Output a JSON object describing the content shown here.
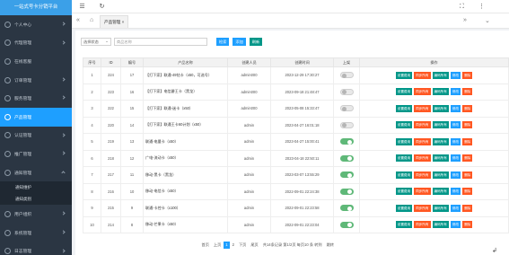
{
  "brand": "一站式号卡分销平台",
  "nav": [
    {
      "label": "个人中心",
      "chev": true
    },
    {
      "label": "代理管理",
      "chev": true
    },
    {
      "label": "在线客服",
      "chev": false
    },
    {
      "label": "订单管理",
      "chev": true
    },
    {
      "label": "服务管理",
      "chev": true
    },
    {
      "label": "产品管理",
      "active": true
    },
    {
      "label": "认证管理",
      "chev": true
    },
    {
      "label": "推广管理",
      "chev": true
    },
    {
      "label": "通知管理",
      "chev": true,
      "open": true,
      "subs": [
        "通知维护",
        "通知类别"
      ]
    },
    {
      "label": "用户组织",
      "chev": true
    },
    {
      "label": "系统管理",
      "chev": true
    },
    {
      "label": "日志管理",
      "chev": true
    }
  ],
  "topbar": {
    "menu_icon": "menu-icon",
    "refresh_icon": "refresh-icon"
  },
  "tabs": {
    "current": "产品管理"
  },
  "toolbar": {
    "select_value": "选择状态",
    "search_placeholder": "商品名称",
    "search_label": "检索",
    "add_label": "添加",
    "refresh_label": "刷新"
  },
  "table": {
    "headers": [
      "序号",
      "ID",
      "编号",
      "产品名称",
      "创建人员",
      "创建时间",
      "上架",
      "操作"
    ],
    "actions": [
      "设置费用",
      "同步所有",
      "编码所有",
      "修改",
      "删除"
    ],
    "rows": [
      {
        "seq": "1",
        "id": "224",
        "no": "17",
        "name": "【打下家】联通-49钻卡（x50，可选号）",
        "creator": "admin000",
        "time": "2023-12-29 17:30:27",
        "on": false
      },
      {
        "seq": "2",
        "id": "223",
        "no": "16",
        "name": "【打下家】电信爵王卡（黑龙）",
        "creator": "admin000",
        "time": "2023-09-18 21:48:47",
        "on": false
      },
      {
        "seq": "3",
        "id": "222",
        "no": "15",
        "name": "【打下家】联通-迷卡（x50）",
        "creator": "admin000",
        "time": "2023-05-08 15:33:47",
        "on": false
      },
      {
        "seq": "4",
        "id": "220",
        "no": "14",
        "name": "【打下家】联通王卡60计划（x50）",
        "creator": "admin",
        "time": "2023-04-27 16:01:18",
        "on": false
      },
      {
        "seq": "5",
        "id": "219",
        "no": "13",
        "name": "联通-电量卡（x50）",
        "creator": "admin",
        "time": "2023-04-27 15:00:41",
        "on": true
      },
      {
        "seq": "6",
        "id": "218",
        "no": "12",
        "name": "广电-流动卡（x50）",
        "creator": "admin",
        "time": "2023-04-18 22:50:11",
        "on": true
      },
      {
        "seq": "7",
        "id": "217",
        "no": "11",
        "name": "移动-黑卡（黑龙）",
        "creator": "admin",
        "time": "2023-03-07 13:55:29",
        "on": true
      },
      {
        "seq": "8",
        "id": "216",
        "no": "10",
        "name": "移动-电信卡（x50）",
        "creator": "admin",
        "time": "2022-09-01 22:24:38",
        "on": true
      },
      {
        "seq": "9",
        "id": "215",
        "no": "9",
        "name": "联通-卡控卡（x100）",
        "creator": "admin",
        "time": "2022-09-01 22:23:58",
        "on": true
      },
      {
        "seq": "10",
        "id": "214",
        "no": "8",
        "name": "移动-芒果卡（x50）",
        "creator": "admin",
        "time": "2022-09-01 22:23:04",
        "on": true
      }
    ]
  },
  "pager": {
    "first": "首页",
    "prev": "上页",
    "pages": [
      "1",
      "2"
    ],
    "next": "下页",
    "last": "尾页",
    "summary": "共14条记录 第1/2页 每页10 条 转到",
    "jump": "跳转"
  },
  "colors": {
    "sidebar": "#2b3643",
    "brand": "#3ba0e8",
    "active": "#1e9fff",
    "teal": "#009688",
    "orange": "#ff5722",
    "switch_on": "#5fb878"
  }
}
